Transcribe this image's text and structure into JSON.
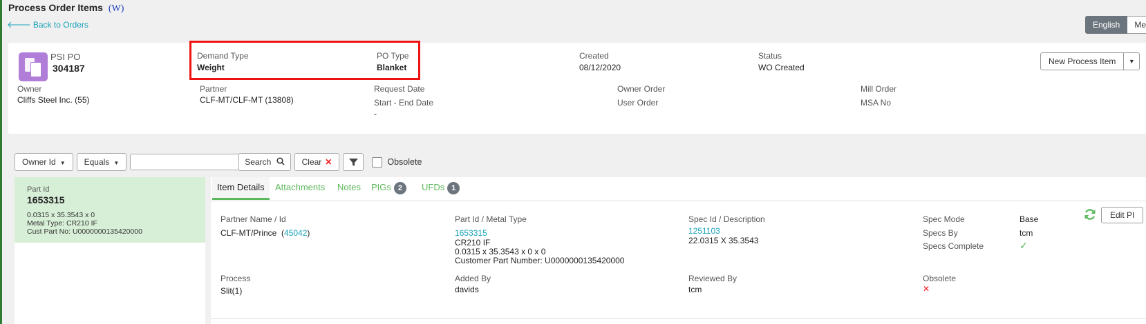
{
  "page": {
    "title": "Process Order Items",
    "title_suffix": "(W)",
    "back_link": "Back to Orders",
    "languages": [
      "English",
      "Me"
    ]
  },
  "header": {
    "po_type_label": "PSI PO",
    "po_number": "304187",
    "demand_type_label": "Demand Type",
    "demand_type_value": "Weight",
    "po_type_field_label": "PO Type",
    "po_type_value": "Blanket",
    "created_label": "Created",
    "created_value": "08/12/2020",
    "status_label": "Status",
    "status_value": "WO Created",
    "new_process_button": "New Process Item",
    "owner_label": "Owner",
    "owner_value": "Cliffs Steel Inc. (55)",
    "partner_label": "Partner",
    "partner_value": "CLF-MT/CLF-MT (13808)",
    "request_date_label": "Request Date",
    "start_end_label": "Start - End Date",
    "start_end_value": "-",
    "owner_order_label": "Owner Order",
    "user_order_label": "User Order",
    "mill_order_label": "Mill Order",
    "msa_no_label": "MSA No"
  },
  "filters": {
    "field_select": "Owner Id",
    "operator_select": "Equals",
    "search_value": "",
    "search_button": "Search",
    "clear_button": "Clear",
    "obsolete_label": "Obsolete"
  },
  "part_list": [
    {
      "label": "Part Id",
      "id": "1653315",
      "dims": "0.0315 x 35.3543 x 0",
      "metal_type": "Metal Type: CR210 IF",
      "cust_part": "Cust Part No: U0000000135420000"
    }
  ],
  "tabs": [
    {
      "label": "Item Details"
    },
    {
      "label": "Attachments"
    },
    {
      "label": "Notes"
    },
    {
      "label": "PIGs",
      "badge": "2"
    },
    {
      "label": "UFDs",
      "badge": "1"
    }
  ],
  "details": {
    "edit_button": "Edit PI",
    "partner_label": "Partner Name / Id",
    "partner_name": "CLF-MT/Prince",
    "partner_id": "45042",
    "part_label": "Part Id / Metal Type",
    "part_id": "1653315",
    "metal_type": "CR210 IF",
    "part_dims": "0.0315 x 35.3543 x 0 x 0",
    "customer_part": "Customer Part Number: U0000000135420000",
    "spec_label": "Spec Id / Description",
    "spec_id": "1251103",
    "spec_desc": "22.0315 X 35.3543",
    "spec_mode_label": "Spec Mode",
    "spec_mode_value": "Base",
    "specs_by_label": "Specs By",
    "specs_by_value": "tcm",
    "specs_complete_label": "Specs Complete",
    "process_label": "Process",
    "process_value": "Slit(1)",
    "added_by_label": "Added By",
    "added_by_value": "davids",
    "reviewed_by_label": "Reviewed By",
    "reviewed_by_value": "tcm",
    "obsolete_label": "Obsolete"
  },
  "colors": {
    "accent_green": "#5cb85c",
    "link_teal": "#17a2b8",
    "po_icon": "#b07dd8",
    "highlight_red": "#e11111",
    "selected_row": "#d7efd7"
  }
}
